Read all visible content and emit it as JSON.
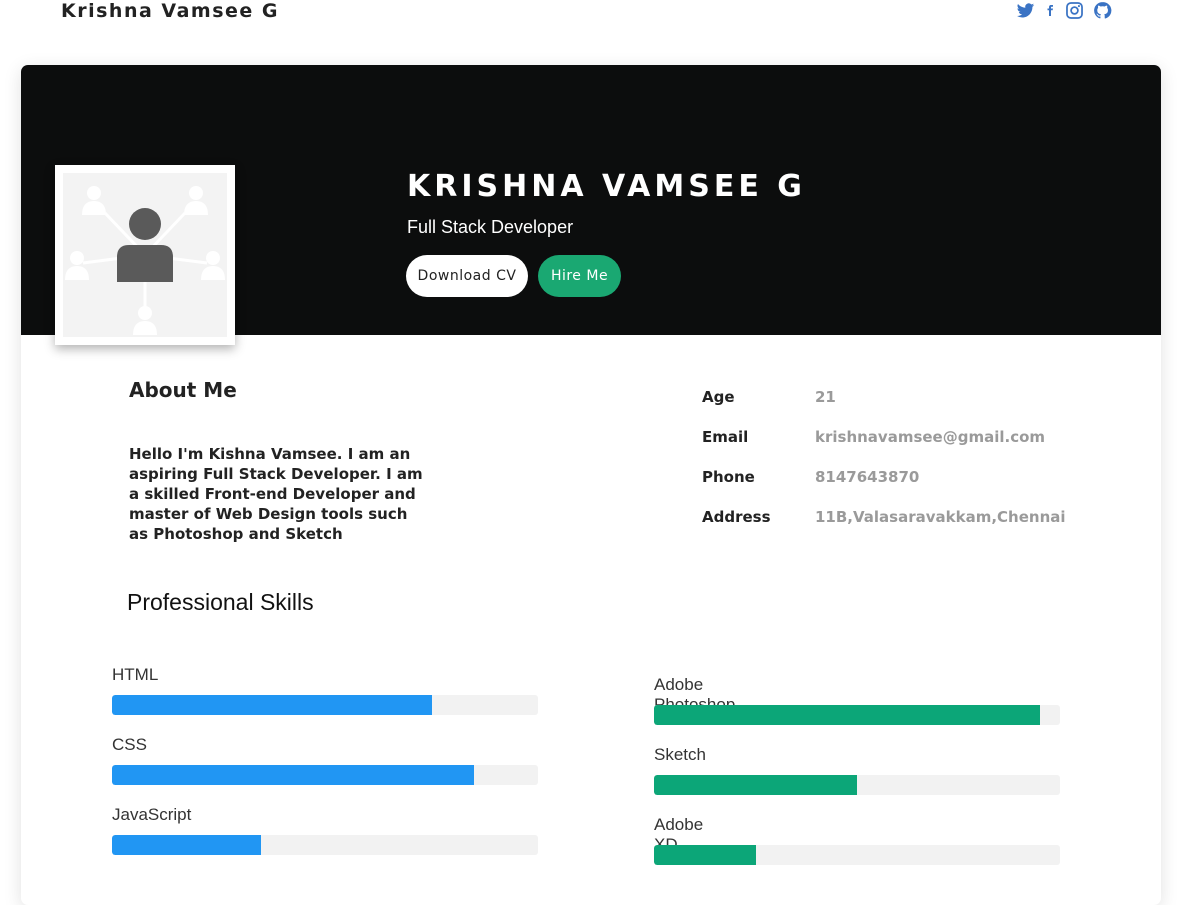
{
  "header": {
    "brand": "Krishna Vamsee G",
    "social_icons": [
      "twitter-icon",
      "facebook-icon",
      "instagram-icon",
      "github-icon"
    ]
  },
  "hero": {
    "name": "KRISHNA VAMSEE G",
    "role": "Full Stack Developer",
    "download_label": "Download CV",
    "hire_label": "Hire Me",
    "avatar_icon": "network-user-icon"
  },
  "about": {
    "title": "About Me",
    "text": "Hello I'm Kishna Vamsee. I am an aspiring Full Stack Developer. I am a skilled Front-end Developer and master of Web Design tools such as Photoshop and Sketch"
  },
  "info": [
    {
      "key": "Age",
      "value": "21"
    },
    {
      "key": "Email",
      "value": "krishnavamsee@gmail.com"
    },
    {
      "key": "Phone",
      "value": "8147643870"
    },
    {
      "key": "Address",
      "value": "11B,Valasaravakkam,Chennai"
    }
  ],
  "skills": {
    "title": "Professional Skills",
    "left": [
      {
        "label": "HTML",
        "level": 0.75
      },
      {
        "label": "CSS",
        "level": 0.85
      },
      {
        "label": "JavaScript",
        "level": 0.35
      }
    ],
    "right": [
      {
        "label": "Adobe Photoshop",
        "level": 0.95
      },
      {
        "label": "Sketch",
        "level": 0.5
      },
      {
        "label": "Adobe XD",
        "level": 0.25
      }
    ]
  },
  "colors": {
    "hero_bg": "#0c0d0d",
    "accent_green": "#1aa872",
    "skill_blue": "#2196f3",
    "skill_green": "#0ca678",
    "social_blue": "#3a73c4"
  }
}
